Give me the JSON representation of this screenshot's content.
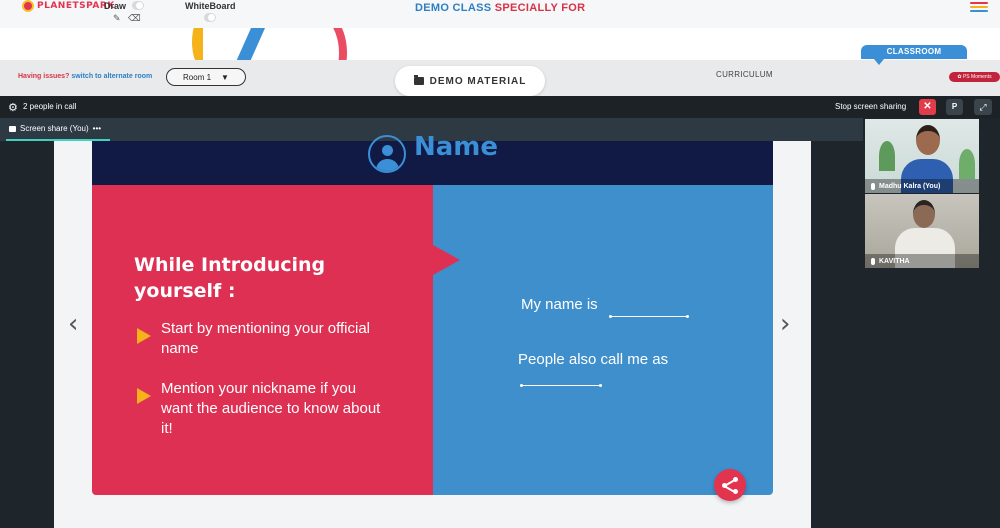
{
  "header": {
    "brand": "PLANETSPARK",
    "draw_label": "Draw",
    "whiteboard_label": "WhiteBoard",
    "title_part1": "DEMO CLASS",
    "title_part2": "SPECIALLY FOR",
    "hamburger_colors": [
      "#e2334f",
      "#f5b21b",
      "#3a8fd6"
    ]
  },
  "navbar": {
    "issues_text": "Having issues?",
    "alternate_link": "switch to alternate room",
    "room_value": "Room 1",
    "room_caret": "▼",
    "demo_material": "DEMO MATERIAL",
    "curriculum": "CURRICULUM",
    "classroom": "CLASSROOM",
    "ps_moments": "✿ PS Moments"
  },
  "call": {
    "people_count": "2 people in call",
    "stop_sharing": "Stop screen sharing",
    "stop_icon": "✕",
    "p_button": "P",
    "share_tab": "Screen share (You)",
    "share_menu": "•••"
  },
  "slide": {
    "name_title": "Name",
    "heading": "While Introducing yourself :",
    "bullets": [
      "Start by mentioning your official name",
      "Mention your nickname if you want the audience to know about it!"
    ],
    "right_line_1": "My name is",
    "right_line_2": "People also call me as",
    "colors": {
      "header": "#101a44",
      "left": "#dd3053",
      "right": "#3f8fcd",
      "accent": "#f5b21b"
    }
  },
  "participants": [
    {
      "name": "Madhu Kalra (You)"
    },
    {
      "name": "KAVITHA"
    }
  ],
  "icons": {
    "gear": "⚙",
    "prev": "‹",
    "next": "›",
    "expand": "⤢",
    "pencil": "✎",
    "eraser": "⌫"
  }
}
